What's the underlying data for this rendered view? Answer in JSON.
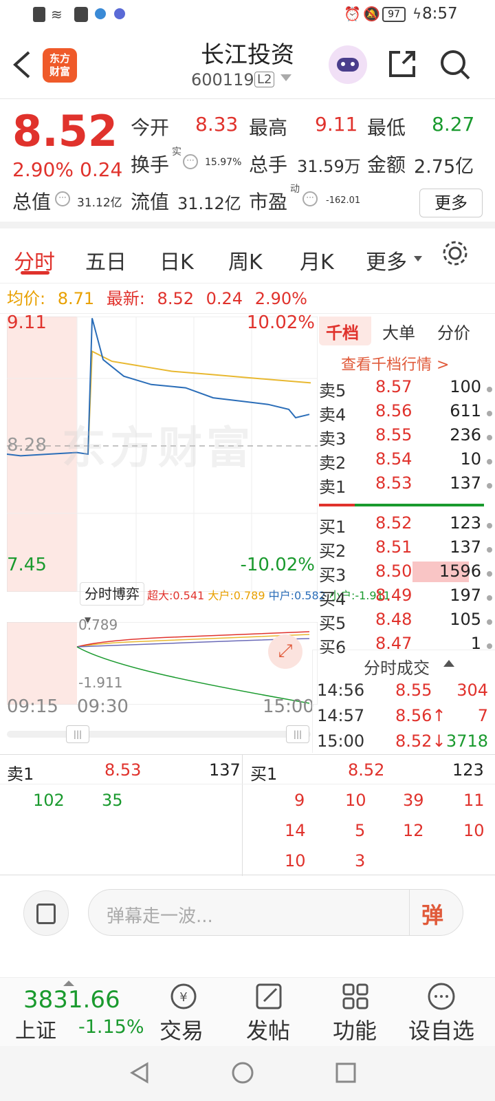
{
  "status": {
    "battery": "97",
    "time": "8:57"
  },
  "header": {
    "title": "长江投资",
    "code": "600119",
    "level": "L2",
    "logo": "东方\n财富"
  },
  "quote": {
    "price": "8.52",
    "pct": "2.90%",
    "chg": "0.24",
    "open_label": "今开",
    "open": "8.33",
    "high_label": "最高",
    "high": "9.11",
    "low_label": "最低",
    "low": "8.27",
    "turnover_label": "换手",
    "turnover_sup": "实",
    "turnover": "15.97%",
    "vol_label": "总手",
    "vol": "31.59万",
    "amount_label": "金额",
    "amount": "2.75亿",
    "mcap_label": "总值",
    "mcap": "31.12亿",
    "float_label": "流值",
    "float": "31.12亿",
    "pe_label": "市盈",
    "pe_sup": "动",
    "pe": "-162.01",
    "more": "更多"
  },
  "tabs": [
    "分时",
    "五日",
    "日K",
    "周K",
    "月K",
    "更多"
  ],
  "avgbar": {
    "avg_label": "均价:",
    "avg": "8.71",
    "last_label": "最新:",
    "last": "8.52",
    "chg": "0.24",
    "pct": "2.90%"
  },
  "chart": {
    "top_price": "9.11",
    "top_pct": "10.02%",
    "mid_price": "8.28",
    "bot_price": "7.45",
    "bot_pct": "-10.02%",
    "watermark": "东方财富"
  },
  "chart_data": {
    "type": "line",
    "x": [
      "09:15",
      "09:30",
      "15:00"
    ],
    "ylim": [
      7.45,
      9.11
    ],
    "reference": 8.28,
    "series": [
      {
        "values": [
          8.28,
          8.27,
          8.28,
          8.29,
          8.28,
          9.1,
          8.85,
          8.75,
          8.7,
          8.68,
          8.62,
          8.6,
          8.58,
          8.55,
          8.5,
          8.52
        ]
      },
      {
        "values": [
          8.28,
          8.9,
          8.84,
          8.82,
          8.8,
          8.78,
          8.77,
          8.76,
          8.75,
          8.74,
          8.73,
          8.72,
          8.71
        ]
      }
    ]
  },
  "game": {
    "selector": "分时博弈",
    "super_label": "超大:",
    "super": "0.541",
    "large_label": "大户:",
    "large": "0.789",
    "mid_label": "中户:",
    "mid": "0.582",
    "small_label": "小户:",
    "small": "-1.911",
    "top": "0.789",
    "bottom": "-1.911"
  },
  "time_axis": {
    "t1": "09:15",
    "t2": "09:30",
    "t3": "15:00"
  },
  "book": {
    "tabs": [
      "千档",
      "大单",
      "分价"
    ],
    "link": "查看千档行情 >",
    "asks": [
      {
        "label": "卖5",
        "price": "8.57",
        "vol": "100"
      },
      {
        "label": "卖4",
        "price": "8.56",
        "vol": "611"
      },
      {
        "label": "卖3",
        "price": "8.55",
        "vol": "236"
      },
      {
        "label": "卖2",
        "price": "8.54",
        "vol": "10"
      },
      {
        "label": "卖1",
        "price": "8.53",
        "vol": "137"
      }
    ],
    "bids": [
      {
        "label": "买1",
        "price": "8.52",
        "vol": "123"
      },
      {
        "label": "买2",
        "price": "8.51",
        "vol": "137"
      },
      {
        "label": "买3",
        "price": "8.50",
        "vol": "1596"
      },
      {
        "label": "买4",
        "price": "8.49",
        "vol": "197"
      },
      {
        "label": "买5",
        "price": "8.48",
        "vol": "105"
      },
      {
        "label": "买6",
        "price": "8.47",
        "vol": "1"
      }
    ]
  },
  "trades": {
    "title": "分时成交",
    "rows": [
      {
        "time": "14:56",
        "price": "8.55",
        "vol": "304"
      },
      {
        "time": "14:57",
        "price": "8.56↑",
        "vol": "7"
      },
      {
        "time": "15:00",
        "price": "8.52↓",
        "vol": "3718"
      }
    ]
  },
  "queue": {
    "sell_label": "卖1",
    "sell_price": "8.53",
    "sell_vol": "137",
    "buy_label": "买1",
    "buy_price": "8.52",
    "buy_vol": "123",
    "sell_q": [
      "102",
      "35"
    ],
    "buy_q": [
      "9",
      "10",
      "39",
      "11",
      "14",
      "5",
      "12",
      "10",
      "10",
      "3"
    ]
  },
  "danmu": {
    "placeholder": "弹幕走一波...",
    "btn": "弹"
  },
  "nav": {
    "index_value": "3831.66",
    "index_name": "上证",
    "index_pct": "-1.15%",
    "items": [
      "交易",
      "发帖",
      "功能",
      "设自选"
    ]
  }
}
